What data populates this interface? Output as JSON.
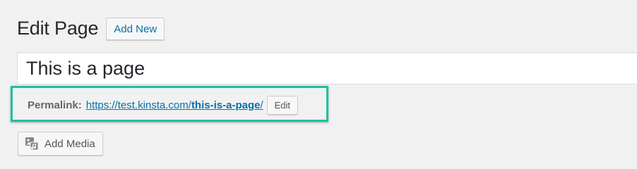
{
  "header": {
    "title": "Edit Page",
    "add_new_label": "Add New"
  },
  "title_field": {
    "value": "This is a page"
  },
  "permalink": {
    "label": "Permalink:",
    "base_url": "https://test.kinsta.com/",
    "slug": "this-is-a-page",
    "trailing": "/",
    "edit_label": "Edit",
    "highlight_color": "#1ac2a0"
  },
  "media": {
    "add_media_label": "Add Media",
    "icon": "media-icon"
  },
  "colors": {
    "background": "#f1f1f1",
    "link": "#0073aa",
    "text": "#23282d"
  }
}
